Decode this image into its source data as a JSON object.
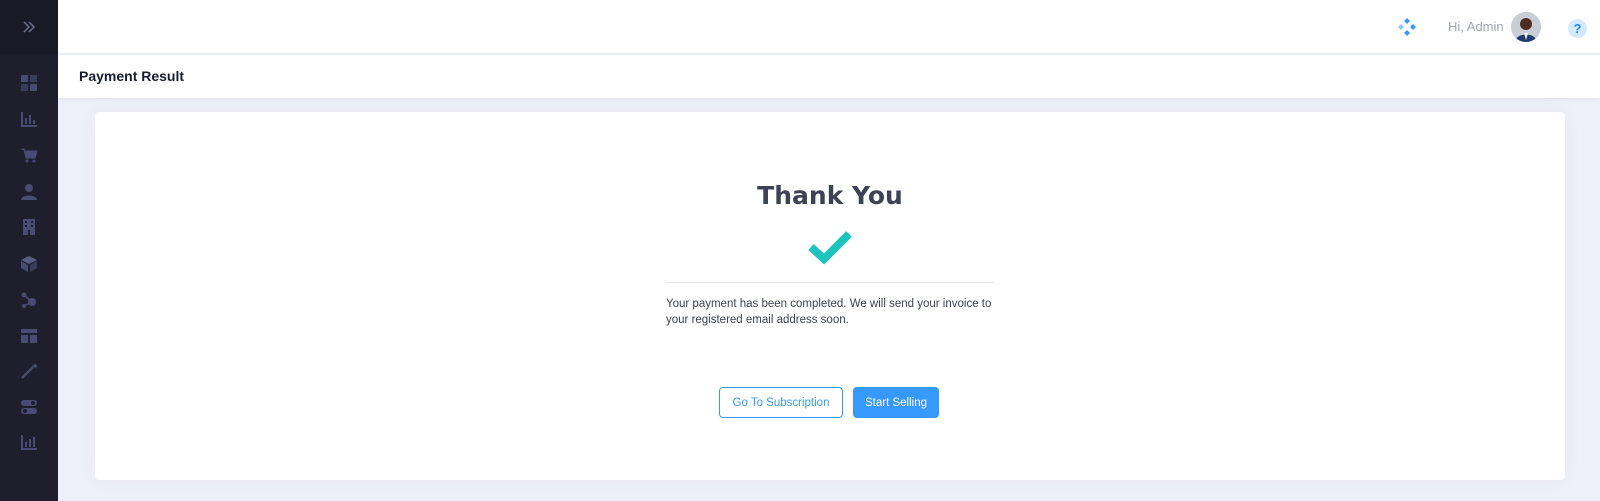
{
  "sidebar": {
    "toggle_icon": "double-chevron-right-icon",
    "items": [
      {
        "icon": "dashboard-icon"
      },
      {
        "icon": "bar-chart-icon"
      },
      {
        "icon": "cart-icon"
      },
      {
        "icon": "user-icon"
      },
      {
        "icon": "building-icon"
      },
      {
        "icon": "box-icon"
      },
      {
        "icon": "network-icon"
      },
      {
        "icon": "layout-icon"
      },
      {
        "icon": "magic-wand-icon"
      },
      {
        "icon": "toggle-icon"
      },
      {
        "icon": "analytics-icon"
      }
    ]
  },
  "header": {
    "greeting": "Hi, Admin",
    "help_label": "?",
    "logo_icon": "diamond-logo-icon"
  },
  "page": {
    "title": "Payment Result"
  },
  "result": {
    "heading": "Thank You",
    "status_icon": "check-icon",
    "message": "Your payment has been completed. We will send your invoice to your registered email address soon.",
    "secondary_button": "Go To Subscription",
    "primary_button": "Start Selling"
  },
  "colors": {
    "sidebar_bg": "#1e1e2d",
    "accent": "#3699ff",
    "success": "#1bc5bd",
    "page_bg": "#eef0f8"
  }
}
